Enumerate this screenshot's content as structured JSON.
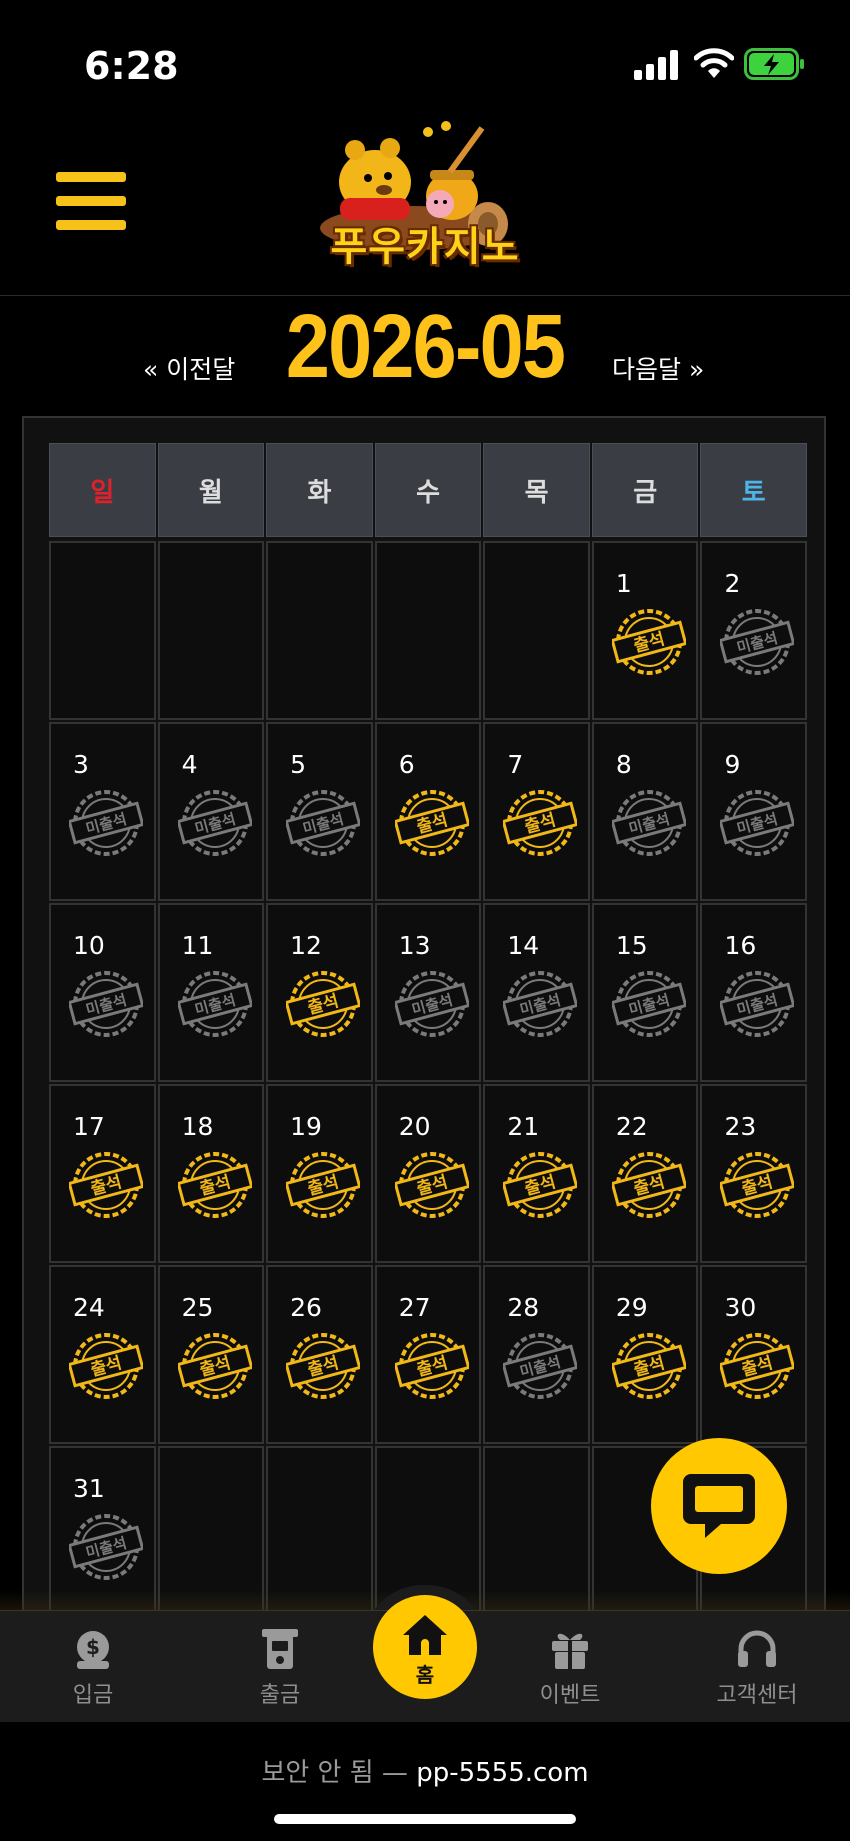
{
  "status_bar": {
    "time": "6:28"
  },
  "header": {
    "logo_text": "푸우카지노"
  },
  "month_nav": {
    "prev_label": "« 이전달",
    "next_label": "다음달 »",
    "title": "2026-05"
  },
  "calendar": {
    "weekdays": [
      "일",
      "월",
      "화",
      "수",
      "목",
      "금",
      "토"
    ],
    "weeks": [
      [
        null,
        null,
        null,
        null,
        null,
        {
          "day": "1",
          "status": "attended"
        },
        {
          "day": "2",
          "status": "absent"
        }
      ],
      [
        {
          "day": "3",
          "status": "absent"
        },
        {
          "day": "4",
          "status": "absent"
        },
        {
          "day": "5",
          "status": "absent"
        },
        {
          "day": "6",
          "status": "attended"
        },
        {
          "day": "7",
          "status": "attended"
        },
        {
          "day": "8",
          "status": "absent"
        },
        {
          "day": "9",
          "status": "absent"
        }
      ],
      [
        {
          "day": "10",
          "status": "absent"
        },
        {
          "day": "11",
          "status": "absent"
        },
        {
          "day": "12",
          "status": "attended"
        },
        {
          "day": "13",
          "status": "absent"
        },
        {
          "day": "14",
          "status": "absent"
        },
        {
          "day": "15",
          "status": "absent"
        },
        {
          "day": "16",
          "status": "absent"
        }
      ],
      [
        {
          "day": "17",
          "status": "attended"
        },
        {
          "day": "18",
          "status": "attended"
        },
        {
          "day": "19",
          "status": "attended"
        },
        {
          "day": "20",
          "status": "attended"
        },
        {
          "day": "21",
          "status": "attended"
        },
        {
          "day": "22",
          "status": "attended"
        },
        {
          "day": "23",
          "status": "attended"
        }
      ],
      [
        {
          "day": "24",
          "status": "attended"
        },
        {
          "day": "25",
          "status": "attended"
        },
        {
          "day": "26",
          "status": "attended"
        },
        {
          "day": "27",
          "status": "attended"
        },
        {
          "day": "28",
          "status": "absent"
        },
        {
          "day": "29",
          "status": "attended"
        },
        {
          "day": "30",
          "status": "attended"
        }
      ],
      [
        {
          "day": "31",
          "status": "absent"
        },
        null,
        null,
        null,
        null,
        null,
        null
      ]
    ],
    "stamps": {
      "attended": "출석",
      "absent": "미출석"
    },
    "colors": {
      "attended": "#f2b818",
      "absent": "#7a7a7a",
      "sunday": "#e0202a",
      "saturday": "#4fb4e8"
    }
  },
  "tabbar": {
    "deposit": "입금",
    "withdraw": "출금",
    "home": "홈",
    "event": "이벤트",
    "support": "고객센터"
  },
  "browser": {
    "security_warning": "보안 안 됨 —",
    "host": "pp-5555.com"
  },
  "colors": {
    "accent": "#ffc800",
    "background": "#000000"
  }
}
